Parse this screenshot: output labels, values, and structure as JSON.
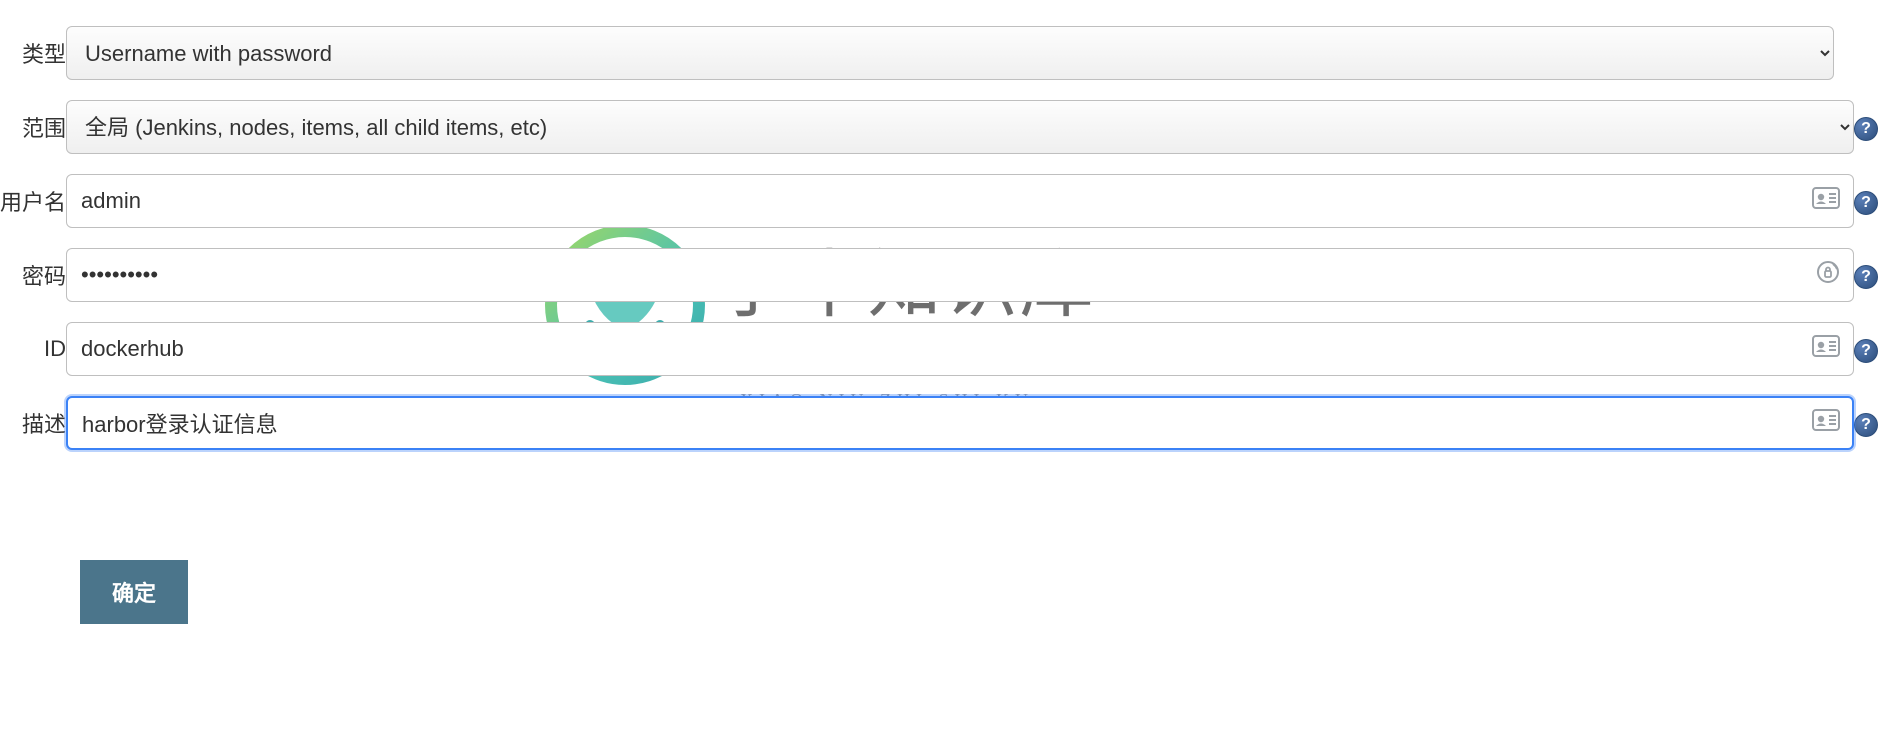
{
  "labels": {
    "type": "类型",
    "scope": "范围",
    "username": "用户名",
    "password": "密码",
    "id": "ID",
    "description": "描述"
  },
  "type_select": {
    "selected": "Username with password"
  },
  "scope_select": {
    "selected": "全局 (Jenkins, nodes, items, all child items, etc)"
  },
  "fields": {
    "username": "admin",
    "password": "••••••••••",
    "id": "dockerhub",
    "description": "harbor登录认证信息"
  },
  "submit_label": "确定",
  "help_glyph": "?",
  "watermark": {
    "title": "小牛知识库",
    "subtitle": "XIAO NIU ZHI SHI KU"
  }
}
